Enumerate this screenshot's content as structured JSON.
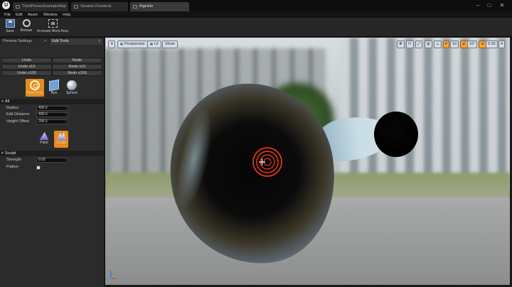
{
  "titlebar": {
    "tabs": [
      {
        "label": "ThirdPersonExampleMap"
      },
      {
        "label": "Session Frontend"
      },
      {
        "label": "BigHole"
      }
    ],
    "window_controls": [
      "minimize",
      "maximize",
      "close"
    ]
  },
  "menu": [
    "File",
    "Edit",
    "Asset",
    "Window",
    "Help"
  ],
  "toolbar": {
    "buttons": [
      {
        "label": "Save",
        "icon": "save-icon"
      },
      {
        "label": "Browse",
        "icon": "browse-icon"
      },
      {
        "label": "Increase Work Area",
        "icon": "expand-icon"
      }
    ]
  },
  "left_panel": {
    "tabs": [
      "Preview Settings",
      "Edit Tools"
    ],
    "history": {
      "undo": "Undo",
      "redo": "Redo",
      "undo_x10": "Undo x10",
      "redo_x10": "Redo x10",
      "undo_x100": "Undo x100",
      "redo_x100": "Redo x100"
    },
    "tools": [
      {
        "label": "PaintTools",
        "icon": "paint-tool-icon",
        "active": true
      },
      {
        "label": "Box",
        "icon": "box-icon",
        "active": false
      },
      {
        "label": "Sphere",
        "icon": "sphere-icon",
        "active": false
      }
    ],
    "section_all": {
      "title": "All",
      "radius_label": "Radius",
      "radius_value": "400.0",
      "edit_distance_label": "Edit Distance",
      "edit_distance_value": "400.0",
      "height_offset_label": "Height Offset",
      "height_offset_value": "200.0"
    },
    "sub_tools": [
      {
        "label": "Paint",
        "icon": "brush-icon",
        "active": false
      },
      {
        "label": "Sculpt",
        "icon": "sculpt-icon",
        "active": true
      }
    ],
    "section_sculpt": {
      "title": "Sculpt",
      "strength_label": "Strength",
      "strength_value": "0.05",
      "flatten_label": "Flatten",
      "flatten_checked": false
    }
  },
  "viewport": {
    "perspective_label": "Perspective",
    "lit_label": "Lit",
    "show_label": "Show",
    "grid_snap_value": "10",
    "rotation_snap_value": "10°",
    "scale_snap_value": "0.25",
    "camera_speed_value": "4",
    "accent_color": "#f4a33a"
  }
}
